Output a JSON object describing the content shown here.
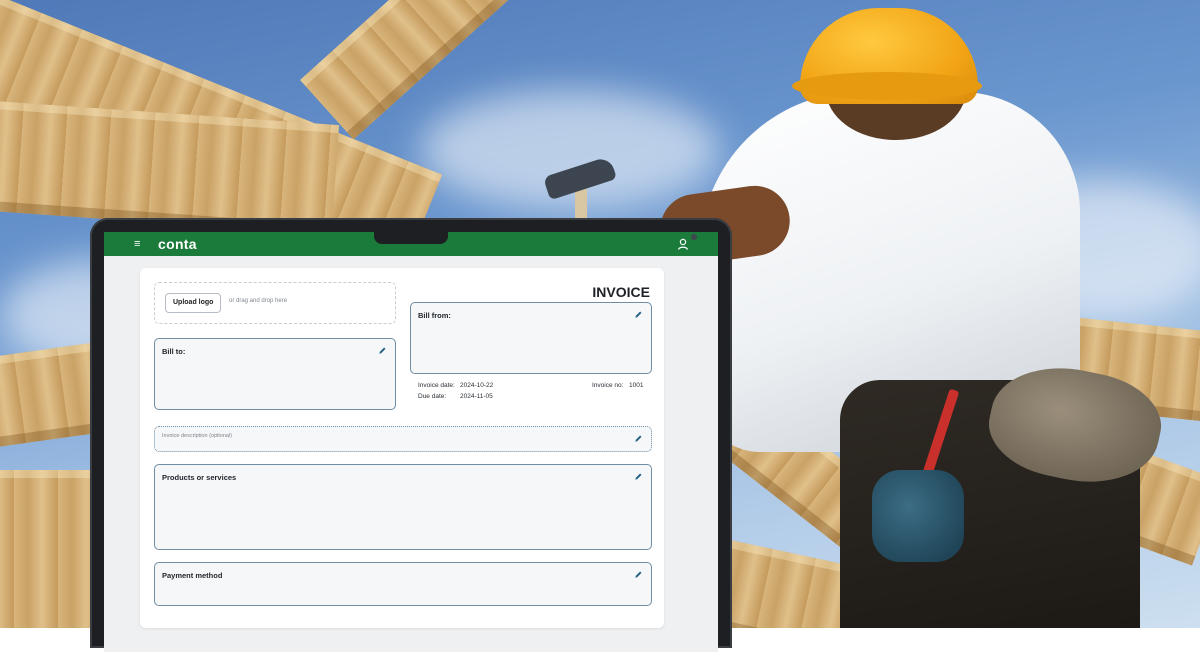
{
  "app": {
    "logo_text": "conta",
    "accent_color": "#1b7b3a"
  },
  "invoice": {
    "title": "INVOICE",
    "upload_logo_label": "Upload logo",
    "drag_drop_text": "or drag and drop here",
    "bill_to_label": "Bill to:",
    "bill_from_label": "Bill from:",
    "invoice_date_label": "Invoice date:",
    "invoice_date_value": "2024-10-22",
    "due_date_label": "Due date:",
    "due_date_value": "2024-11-05",
    "invoice_no_label": "Invoice no:",
    "invoice_no_value": "1001",
    "description_placeholder": "Invoice description (optional)",
    "products_label": "Products or services",
    "payment_label": "Payment method"
  },
  "icons": {
    "menu": "hamburger-menu-icon",
    "user": "user-icon",
    "edit": "pencil-icon"
  }
}
